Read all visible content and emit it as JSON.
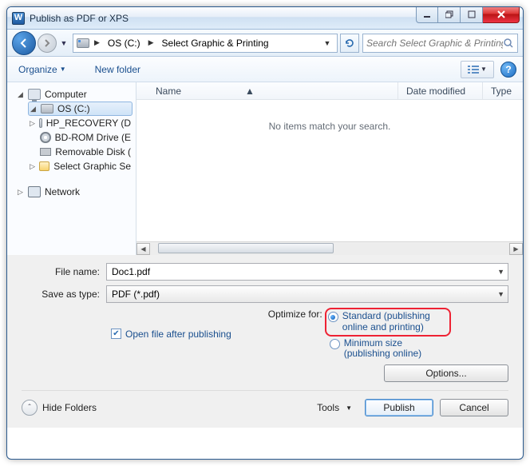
{
  "window": {
    "title": "Publish as PDF or XPS"
  },
  "nav": {
    "breadcrumbs": [
      "OS (C:)",
      "Select Graphic & Printing"
    ],
    "search_placeholder": "Search Select Graphic & Printing"
  },
  "commands": {
    "organize": "Organize",
    "new_folder": "New folder"
  },
  "tree": {
    "computer": "Computer",
    "items": [
      "OS (C:)",
      "HP_RECOVERY (D",
      "BD-ROM Drive (E",
      "Removable Disk (",
      "Select Graphic Se"
    ],
    "network": "Network"
  },
  "list": {
    "columns": {
      "name": "Name",
      "modified": "Date modified",
      "type": "Type"
    },
    "empty": "No items match your search."
  },
  "form": {
    "file_name_label": "File name:",
    "file_name_value": "Doc1.pdf",
    "save_type_label": "Save as type:",
    "save_type_value": "PDF (*.pdf)",
    "open_after": "Open file after publishing",
    "optimize_label": "Optimize for:",
    "opt_standard": "Standard (publishing online and printing)",
    "opt_minimum": "Minimum size (publishing online)",
    "options_btn": "Options..."
  },
  "footer": {
    "hide_folders": "Hide Folders",
    "tools": "Tools",
    "publish": "Publish",
    "cancel": "Cancel"
  }
}
